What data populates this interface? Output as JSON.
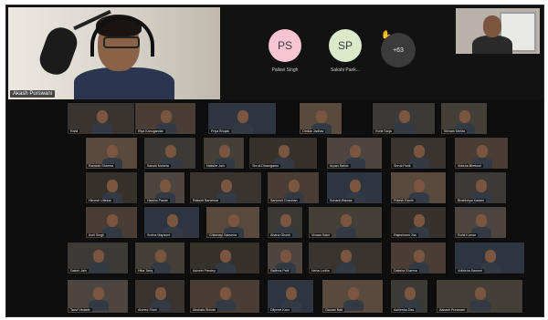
{
  "host": {
    "name": "Akash Purswani"
  },
  "avatars": [
    {
      "initials": "PS",
      "name": "Pallavi Singh",
      "color": "#f7c4d4"
    },
    {
      "initials": "SP",
      "name": "Sakshi Pank...",
      "color": "#d9e9c9"
    }
  ],
  "more": {
    "count": "+63"
  },
  "grid": {
    "rows": [
      [
        "Rahil",
        "Riya Kanugandar",
        "Priya Bhojak",
        "Omkar Jadhav",
        "Rohit Sarja",
        "Shivam Mehta"
      ],
      [
        "Ramesh Sharma",
        "Sakshi Maheta",
        "Nakshe Jain",
        "Shruti Dhamgamo",
        "Arpan Sainie",
        "Shruti Parik",
        "Vidisha Bhetwal"
      ],
      [
        "Himesh Uttekar",
        "Harsha Pawar",
        "Rakshit Banshkar",
        "Sankesh Chauhan",
        "Suhanit Biswas",
        "Pritesh Rauth",
        "Bhabishya Kadam"
      ],
      [
        "Avril Singh",
        "Sneha Mapsore",
        "Chinmayi Saksena",
        "Ahana Ghosh",
        "Vivaan Saini",
        "Rajeshwari Jha",
        "Rohit Kumar"
      ],
      [
        "Daksh Jain",
        "Hiba Tariq",
        "Ashwin Pandey",
        "Sadhna Patil",
        "Neha Lodha",
        "Daksha Sharma",
        "Vidhisha Sawant"
      ],
      [
        "Tanvi Vedade",
        "Ahmed Shah",
        "Akshata Shinde",
        "Dilpreet Kaur",
        "Gaurav Nair",
        "Ashlesha Das",
        "Aakash Purswani"
      ]
    ]
  }
}
